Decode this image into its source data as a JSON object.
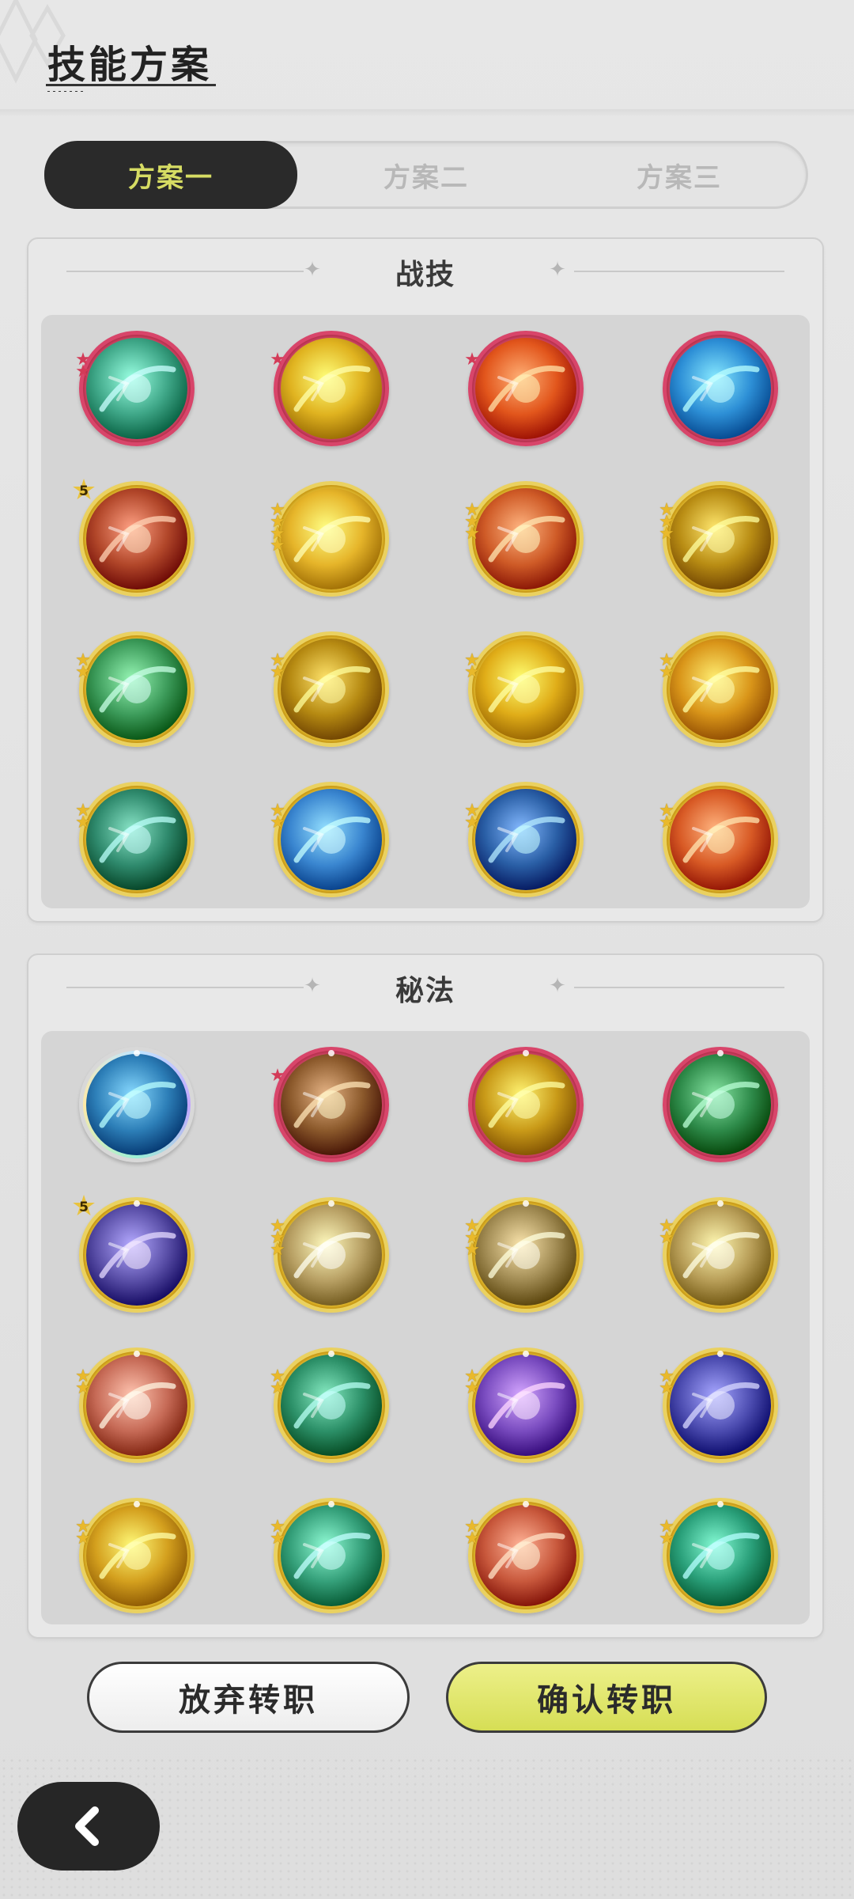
{
  "header": {
    "title": "技能方案"
  },
  "tabs": [
    {
      "label": "方案一",
      "active": true
    },
    {
      "label": "方案二",
      "active": false
    },
    {
      "label": "方案三",
      "active": false
    }
  ],
  "sections": [
    {
      "title": "战技",
      "skills": [
        {
          "icon": "wind-orb-icon",
          "frame": "red",
          "stars": 2,
          "color": "#3fa788"
        },
        {
          "icon": "lightning-orb-icon",
          "frame": "red",
          "stars": 1,
          "color": "#e0b320"
        },
        {
          "icon": "fire-burst-icon",
          "frame": "red",
          "stars": 1,
          "color": "#e2561c"
        },
        {
          "icon": "water-vortex-icon",
          "frame": "red",
          "stars": 0,
          "color": "#2d8fd6"
        },
        {
          "icon": "meteor-icon",
          "frame": "gold",
          "stars": 5,
          "color": "#b2472a"
        },
        {
          "icon": "star-shot-icon",
          "frame": "gold",
          "stars": 4,
          "color": "#e6b52a"
        },
        {
          "icon": "flame-swirl-icon",
          "frame": "gold",
          "stars": 3,
          "color": "#cf5b27"
        },
        {
          "icon": "gold-crystal-icon",
          "frame": "gold",
          "stars": 3,
          "color": "#b98d14"
        },
        {
          "icon": "wind-slash-icon",
          "frame": "gold",
          "stars": 2,
          "color": "#3c9b5a"
        },
        {
          "icon": "lightning-slash-icon",
          "frame": "gold",
          "stars": 2,
          "color": "#b68a12"
        },
        {
          "icon": "golden-guardian-icon",
          "frame": "gold",
          "stars": 2,
          "color": "#e0ad18"
        },
        {
          "icon": "light-burst-icon",
          "frame": "gold",
          "stars": 2,
          "color": "#d99519"
        },
        {
          "icon": "thorn-vine-icon",
          "frame": "gold",
          "stars": 2,
          "color": "#2f8a6d"
        },
        {
          "icon": "ice-shard-icon",
          "frame": "gold",
          "stars": 2,
          "color": "#3a86d0"
        },
        {
          "icon": "ice-crystal-icon",
          "frame": "gold",
          "stars": 2,
          "color": "#2a5fa6"
        },
        {
          "icon": "fire-ball-icon",
          "frame": "gold",
          "stars": 2,
          "color": "#d85a25"
        }
      ]
    },
    {
      "title": "秘法",
      "skills": [
        {
          "icon": "water-crystal-icon",
          "frame": "silver",
          "stars": 0,
          "color": "#2d7fb8"
        },
        {
          "icon": "spirit-pray-icon",
          "frame": "red",
          "stars": 1,
          "color": "#8c5a2c"
        },
        {
          "icon": "sun-meditation-icon",
          "frame": "red",
          "stars": 0,
          "color": "#c99a18"
        },
        {
          "icon": "green-claw-icon",
          "frame": "red",
          "stars": 0,
          "color": "#2e8b4a"
        },
        {
          "icon": "arcane-orbit-icon",
          "frame": "gold",
          "stars": 5,
          "color": "#5a4fa8"
        },
        {
          "icon": "holy-figure-icon",
          "frame": "gold",
          "stars": 3,
          "color": "#b8a064"
        },
        {
          "icon": "wing-rush-icon",
          "frame": "gold",
          "stars": 3,
          "color": "#a08a52"
        },
        {
          "icon": "rising-arrow-icon",
          "frame": "gold",
          "stars": 2,
          "color": "#b89e58"
        },
        {
          "icon": "flame-heart-icon",
          "frame": "gold",
          "stars": 2,
          "color": "#c66a56"
        },
        {
          "icon": "nature-heart-icon",
          "frame": "gold",
          "stars": 2,
          "color": "#2c9068"
        },
        {
          "icon": "purple-swirl-icon",
          "frame": "gold",
          "stars": 2,
          "color": "#7a4cc0"
        },
        {
          "icon": "starlight-icon",
          "frame": "gold",
          "stars": 2,
          "color": "#4c4cb0"
        },
        {
          "icon": "radiant-burst-icon",
          "frame": "gold",
          "stars": 2,
          "color": "#d4a01e"
        },
        {
          "icon": "emerald-shield-icon",
          "frame": "gold",
          "stars": 2,
          "color": "#35a07a"
        },
        {
          "icon": "ember-spirit-icon",
          "frame": "gold",
          "stars": 2,
          "color": "#c8583c"
        },
        {
          "icon": "jade-spirit-icon",
          "frame": "gold",
          "stars": 2,
          "color": "#2aa07a"
        }
      ]
    }
  ],
  "actions": {
    "abandon_label": "放弃转职",
    "confirm_label": "确认转职"
  },
  "nav": {
    "back_icon": "chevron-left-icon"
  },
  "colors": {
    "accent": "#d6dc63",
    "dark": "#2a2a2a",
    "confirm": "#dfe56b"
  }
}
